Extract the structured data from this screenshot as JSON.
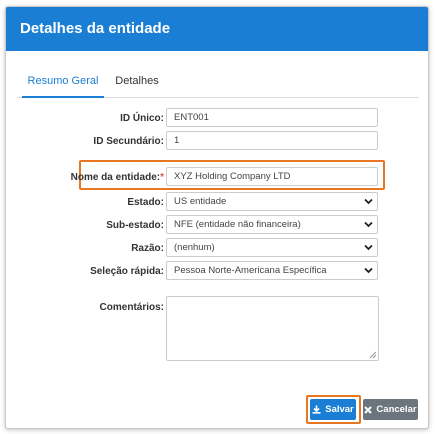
{
  "dialog": {
    "title": "Detalhes da entidade"
  },
  "tabs": [
    {
      "label": "Resumo Geral",
      "active": true
    },
    {
      "label": "Detalhes",
      "active": false
    }
  ],
  "form": {
    "id_unico": {
      "label": "ID Único:",
      "value": "ENT001"
    },
    "id_secundario": {
      "label": "ID Secundário:",
      "value": "1"
    },
    "nome_entidade": {
      "label": "Nome da entidade:",
      "required_marker": "*",
      "value": "XYZ Holding Company LTD"
    },
    "estado": {
      "label": "Estado:",
      "value": "US entidade"
    },
    "sub_estado": {
      "label": "Sub-estado:",
      "value": "NFE (entidade não financeira)"
    },
    "razao": {
      "label": "Razão:",
      "value": "(nenhum)"
    },
    "selecao_rapida": {
      "label": "Seleção rápida:",
      "value": "Pessoa Norte-Americana Específica"
    },
    "comentarios": {
      "label": "Comentários:",
      "value": ""
    }
  },
  "buttons": {
    "save_label": "Salvar",
    "cancel_label": "Cancelar"
  },
  "icons": {
    "save": "download-icon",
    "cancel": "close-icon",
    "select": "chevron-down-icon"
  },
  "colors": {
    "header": "#1a7fd4",
    "primary": "#1a7fd4",
    "secondary": "#6c757d",
    "highlight": "#e87722",
    "required": "#d9534f"
  }
}
